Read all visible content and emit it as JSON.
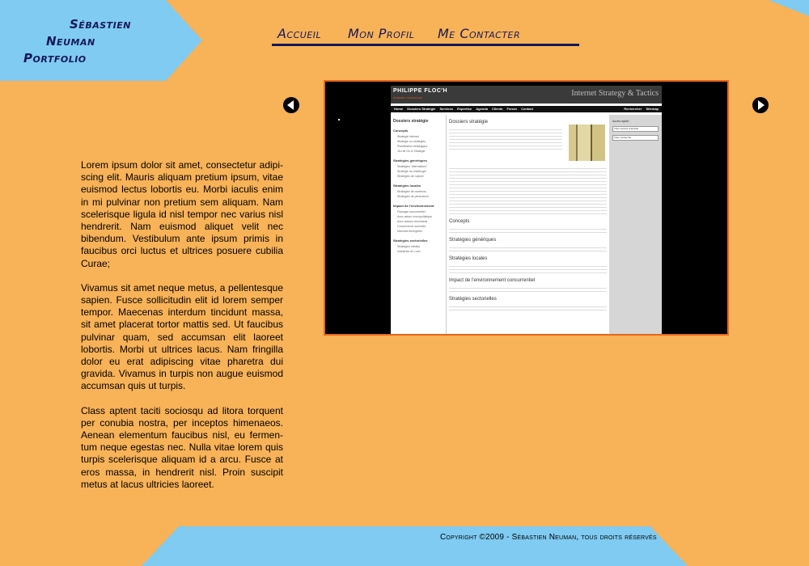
{
  "brand": {
    "line1": "Sébastien",
    "line2": "Neuman",
    "line3": "Portfolio"
  },
  "nav": {
    "items": [
      "Accueil",
      "Mon Profil",
      "Me Contacter"
    ]
  },
  "gallery": {
    "preview": {
      "brand": "PHILIPPE FLOC'H",
      "tagline": "STRATEGY CONSULTING",
      "title": "Internet Strategy & Tactics",
      "menu": [
        "Home",
        "Dossiers Stratégie",
        "Services",
        "Expertise",
        "Agenda",
        "Clients",
        "Forum",
        "Contact"
      ],
      "menu_right": [
        "Rechercher",
        "Sitemap"
      ],
      "sidebar_title": "Dossiers stratégie",
      "sidebar_sections": [
        {
          "heading": "Concepts",
          "items": [
            "Stratégie Internet",
            "Stratégie ou stratégies",
            "Planification stratégique",
            "Jeu de Go & Stratégie"
          ]
        },
        {
          "heading": "Stratégies génériques",
          "items": [
            "Stratégies \"alternatives\"",
            "Stratégie du challenger",
            "Stratégies de rupture"
          ]
        },
        {
          "heading": "Stratégies locales",
          "items": [
            "Stratégies de contenus",
            "Stratégies de persuasion"
          ]
        },
        {
          "heading": "Impact de l'environnement",
          "items": [
            "Paysage concurrentiel",
            "Avec acteur monopolistique",
            "Avec acteurs dominants",
            "Concurrence morcelée",
            "Marchés émergents"
          ]
        },
        {
          "heading": "Stratégies sectorielles",
          "items": [
            "Stratégies médias",
            "Industries du Luxe"
          ]
        }
      ],
      "main_title": "Dossiers stratégie",
      "main_sections": [
        "Concepts",
        "Stratégies génériques",
        "Stratégies locales",
        "Impact de l'environnement concurrentiel",
        "Stratégies sectorielles"
      ],
      "right_title": "Accès rapide :",
      "right_selects": [
        "Votre secteur d'activité",
        "Votre recherche"
      ]
    }
  },
  "content": {
    "paragraphs": [
      "Lorem ipsum dolor sit amet, consectetur adipi­scing elit. Mauris aliquam pretium ipsum, vitae euismod lectus lobortis eu. Morbi iaculis enim in mi pulvinar non pretium sem aliquam. Nam scelerisque ligula id nisl tempor nec varius nisl hendrerit. Nam euismod aliquet velit nec biben­dum. Vestibulum ante ipsum primis in faucibus orci luctus et ultrices posuere cubilia Curae;",
      "Vivamus sit amet neque metus, a pellentesque sapien. Fusce sollicitudin elit id lorem semper tempor. Maecenas interdum tincidunt massa, sit amet placerat tortor mattis sed. Ut faucibus pulvinar quam, sed accumsan elit laoreet lobortis. Morbi ut ultrices lacus. Nam fringilla dolor eu erat adipiscing vitae pharetra dui gravida. Vivamus in turpis non augue euismod accumsan quis ut turpis.",
      "Class aptent taciti sociosqu ad litora torquent per conubia nostra, per inceptos himenaeos. Aenean elementum faucibus nisl, eu fermen­tum neque egestas nec. Nulla vitae lorem quis turpis scelerisque aliquam id a arcu. Fusce at eros massa, in hendrerit nisl. Proin suscipit metus at lacus ultricies laoreet."
    ]
  },
  "footer": {
    "copyright": "Copyright ©2009 - Sébastien Neuman, tous droits réservés"
  },
  "colors": {
    "background": "#f8b257",
    "accent_blue": "#7fcbf2",
    "navy": "#14185a",
    "frame": "#e8661b"
  },
  "icons": {
    "prev": "arrow-left-circle-icon",
    "next": "arrow-right-circle-icon"
  }
}
